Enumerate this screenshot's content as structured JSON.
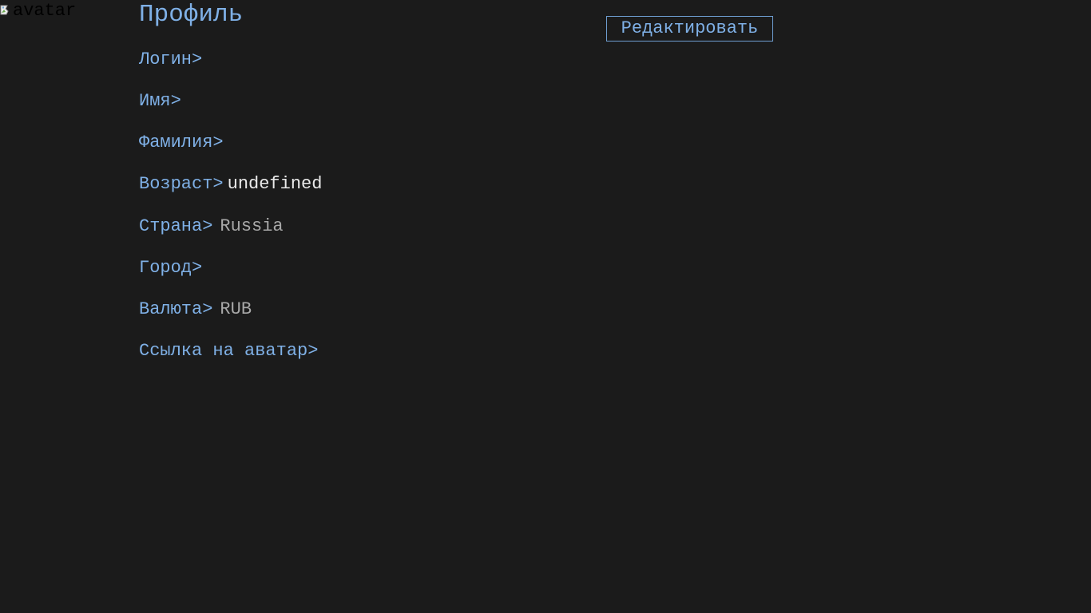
{
  "avatar": {
    "alt_text": "avatar",
    "icon": "broken-image-icon"
  },
  "profile": {
    "title": "Профиль",
    "edit_label": "Редактировать",
    "fields": {
      "login": {
        "label": "Логин>",
        "value": ""
      },
      "first_name": {
        "label": "Имя>",
        "value": ""
      },
      "last_name": {
        "label": "Фамилия>",
        "value": ""
      },
      "age": {
        "label": "Возраст>",
        "value": "undefined"
      },
      "country": {
        "label": "Страна>",
        "value": "Russia"
      },
      "city": {
        "label": "Город>",
        "value": ""
      },
      "currency": {
        "label": "Валюта>",
        "value": "RUB"
      },
      "avatar_link": {
        "label": "Ссылка на аватар>",
        "value": ""
      }
    }
  },
  "colors": {
    "background": "#1b1b1b",
    "accent": "#7fb0e6",
    "value_text": "#eaeaea",
    "muted_value": "#a8a8a8"
  }
}
